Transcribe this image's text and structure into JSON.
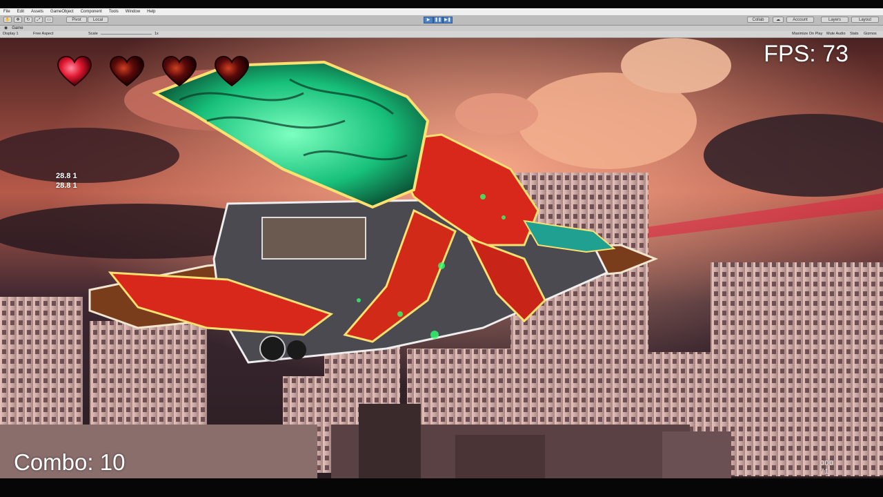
{
  "menu": [
    "File",
    "Edit",
    "Assets",
    "GameObject",
    "Component",
    "Tools",
    "Window",
    "Help"
  ],
  "toolbar": {
    "pivot_label": "Pivot",
    "local_label": "Local",
    "collab_label": "Collab",
    "account_label": "Account",
    "layers_label": "Layers",
    "layout_label": "Layout"
  },
  "game_tab": {
    "title": "Game",
    "display": "Display 1",
    "aspect": "Free Aspect",
    "scale_label": "Scale",
    "scale_value": "1x",
    "maximize": "Maximize On Play",
    "mute": "Mute Audio",
    "stats": "Stats",
    "gizmos": "Gizmos"
  },
  "hud": {
    "fps_text": "FPS: 73",
    "combo_text": "Combo: 10",
    "debug_lines": [
      "28.8 1",
      "28.8 1"
    ],
    "counter_lines": [
      "000",
      "71"
    ],
    "lives_total": 4,
    "lives_full": 1,
    "heart_full_color": "#e01830",
    "heart_empty_color": "#5a0a0a"
  },
  "scene": {
    "sky_top": "#3a1a1c",
    "sky_glow": "#d9735f",
    "cloud_color": "#f0a080",
    "building_color": "#d8b6b2",
    "beast_shell_color": "#1fd080",
    "beast_body_color": "#d8281c",
    "rider_outline": "#ffe070"
  }
}
